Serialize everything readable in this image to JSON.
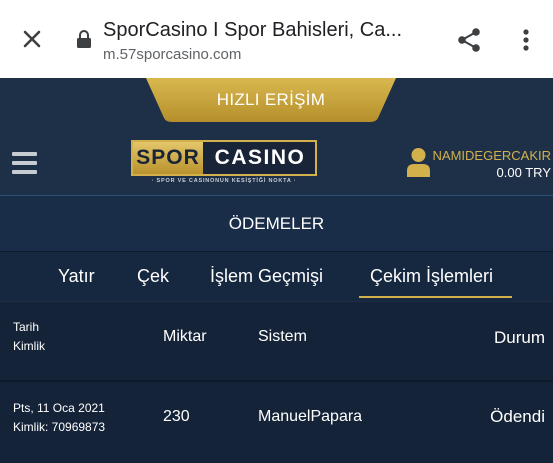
{
  "browser": {
    "title": "SporCasino I Spor Bahisleri, Ca...",
    "url": "m.57sporcasino.com"
  },
  "header": {
    "quick_access": "HIZLI ERİŞİM",
    "logo_spor": "SPOR",
    "logo_casino": "CASINO",
    "logo_tagline": "· SPOR VE CASINONUN KESİŞTİĞİ NOKTA ·",
    "username": "NAMIDEGERCAKIR",
    "balance": "0.00 TRY"
  },
  "section": {
    "title": "ÖDEMELER"
  },
  "tabs": [
    {
      "label": "Yatır"
    },
    {
      "label": "Çek"
    },
    {
      "label": "İşlem Geçmişi"
    },
    {
      "label": "Çekim İşlemleri",
      "active": true
    }
  ],
  "table": {
    "headers": {
      "date": "Tarih",
      "id": "Kimlik",
      "amount": "Miktar",
      "system": "Sistem",
      "status": "Durum"
    },
    "rows": [
      {
        "date": "Pts, 11 Oca 2021",
        "id": "Kimlik: 70969873",
        "amount": "230",
        "system": "ManuelPapara",
        "status": "Ödendi"
      }
    ]
  },
  "colors": {
    "accent_gold": "#d2b14c",
    "header_bg": "#1e3047",
    "table_bg": "#152338"
  },
  "icons": [
    "close-icon",
    "lock-icon",
    "share-icon",
    "more-vert-icon",
    "hamburger-icon",
    "user-icon"
  ]
}
